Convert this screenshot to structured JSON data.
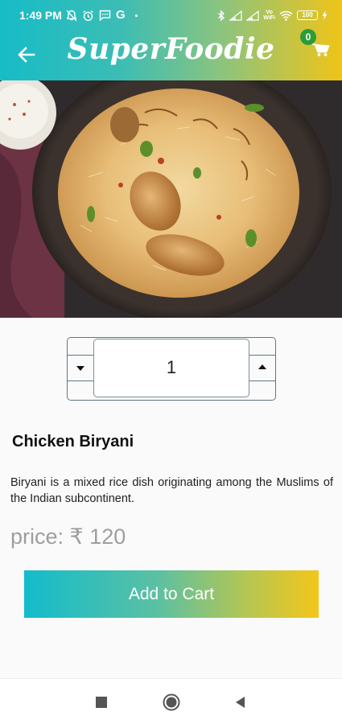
{
  "status_bar": {
    "time": "1:49 PM",
    "g_label": "G",
    "network_label": "Vo\nWiFi",
    "battery": "100"
  },
  "app_bar": {
    "brand": "SuperFoodie",
    "cart_count": "0"
  },
  "product": {
    "image_icon": "chicken-biryani-photo",
    "quantity": "1",
    "name": "Chicken Biryani",
    "description": "Biryani is a mixed rice dish originating among the Muslims of the Indian subcontinent.",
    "price_label": "price: ₹ 120",
    "add_to_cart_label": "Add to Cart"
  },
  "colors": {
    "gradient_start": "#17bcc7",
    "gradient_end": "#f0c418",
    "badge": "#2e9c36",
    "stepper_border": "#5f7783"
  }
}
